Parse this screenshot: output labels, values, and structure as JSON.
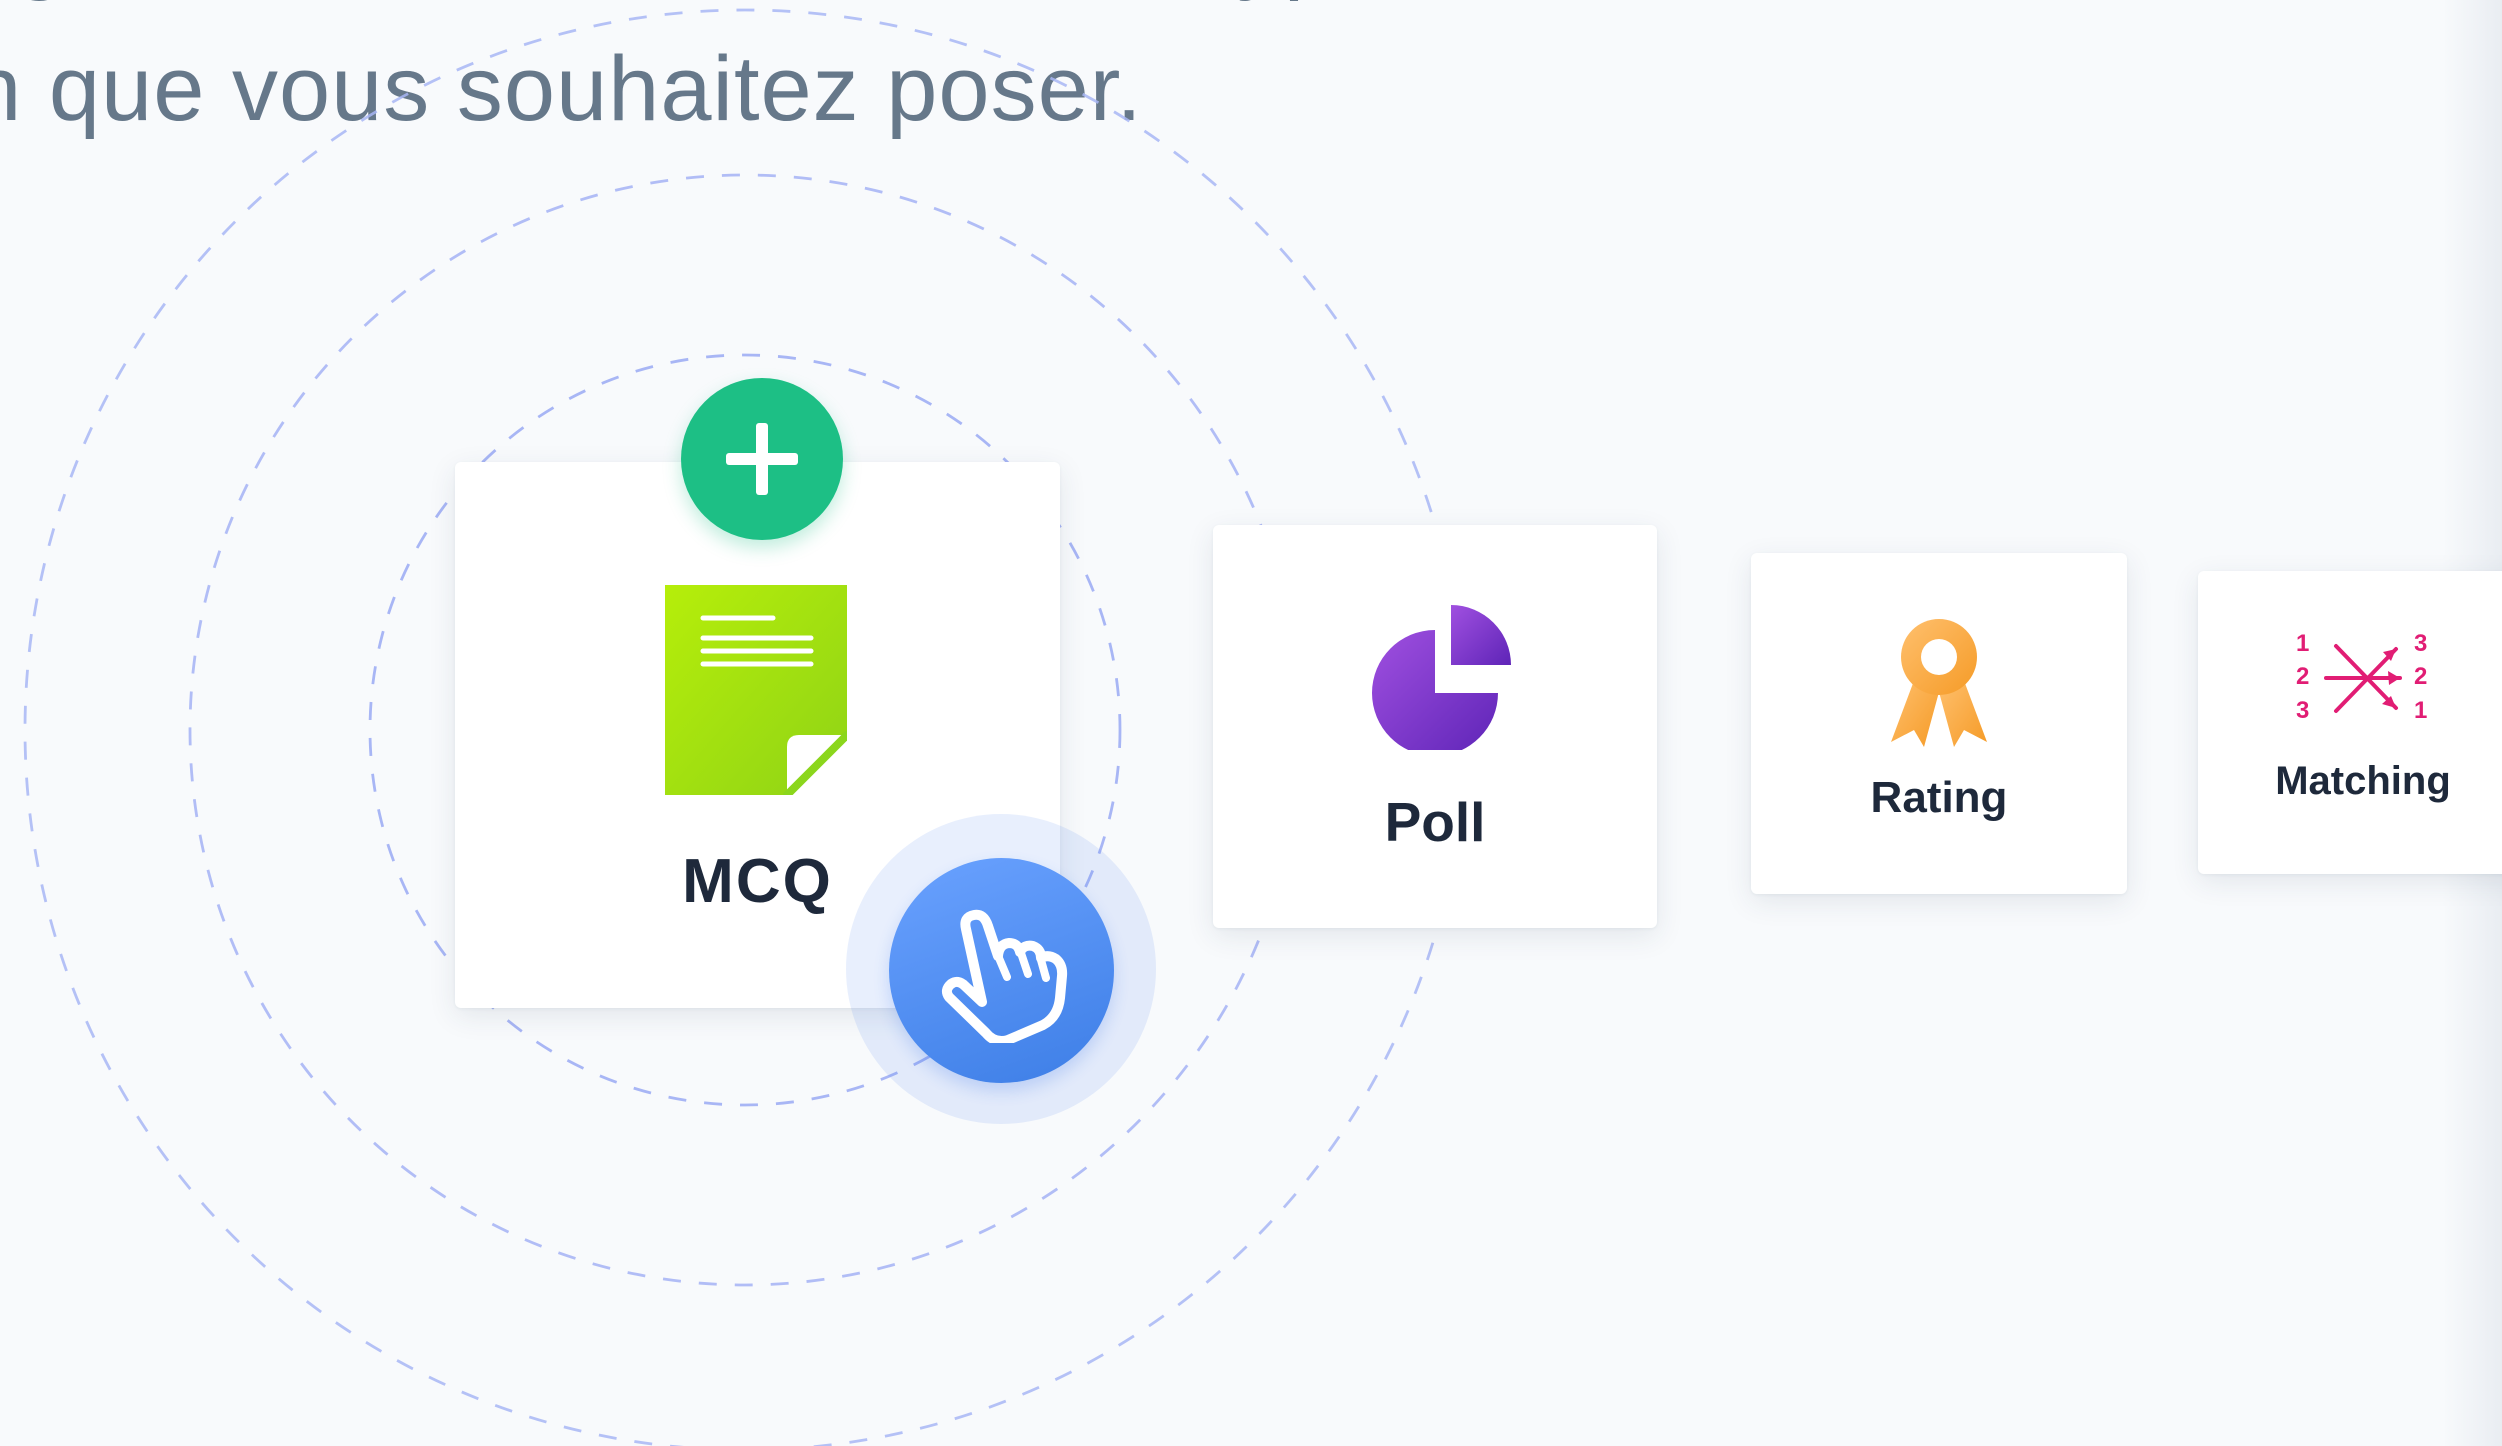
{
  "instruction": {
    "line_1": "l'onglet des votes, choisissez le type de",
    "line_2": "tion que vous souhaitez poser."
  },
  "question_types": [
    {
      "label": "MCQ",
      "icon": "document-icon",
      "color": "#8ed316"
    },
    {
      "label": "Poll",
      "icon": "pie-chart-icon",
      "color": "#7c3aed"
    },
    {
      "label": "Rating",
      "icon": "award-ribbon-icon",
      "color": "#f6ad55"
    },
    {
      "label": "Matching",
      "icon": "matching-arrows-icon",
      "color": "#e11d74"
    }
  ],
  "matching_icon_numbers": {
    "left": [
      "1",
      "2",
      "3"
    ],
    "right": [
      "3",
      "2",
      "1"
    ]
  },
  "controls": {
    "add_icon": "plus-icon",
    "pointer_icon": "hand-pointer-icon",
    "add_color": "#1dbf85",
    "pointer_color": "#4a88f0"
  }
}
